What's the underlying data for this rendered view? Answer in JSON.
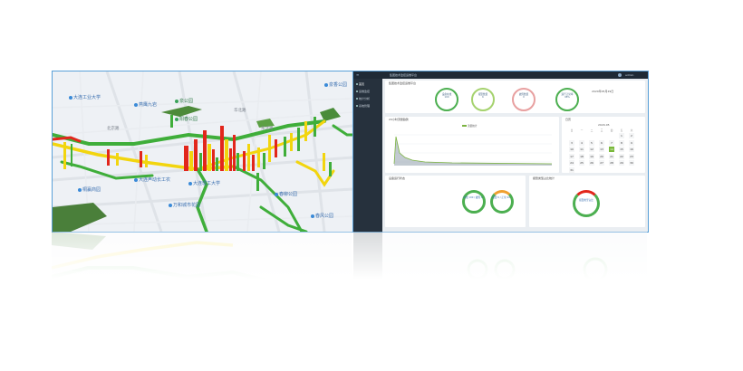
{
  "map": {
    "pois": [
      {
        "name": "大连工业大学",
        "tone": "blue"
      },
      {
        "name": "燕鹰九岩",
        "tone": "blue"
      },
      {
        "name": "泉公园",
        "tone": "green"
      },
      {
        "name": "阳春公园",
        "tone": "green"
      },
      {
        "name": "大连声动长工农",
        "tone": "blue"
      },
      {
        "name": "桐赢商园",
        "tone": "blue"
      },
      {
        "name": "大连理工大学",
        "tone": "blue"
      },
      {
        "name": "万和城市花园",
        "tone": "blue"
      },
      {
        "name": "春柳公园",
        "tone": "blue"
      },
      {
        "name": "泉香公园",
        "tone": "blue"
      },
      {
        "name": "春风公园",
        "tone": "blue"
      }
    ],
    "road_labels": [
      "华北路",
      "东北路",
      "北京路"
    ]
  },
  "dashboard": {
    "app_title": "集团技术监控运维平台",
    "user_label": "admin",
    "sidebar": [
      "首页",
      "运维监控",
      "统计分析",
      "系统管理"
    ],
    "kpi": [
      {
        "label": "设备在线",
        "value": "100",
        "color": "#4caf50"
      },
      {
        "label": "报警数量",
        "value": "6",
        "color": "#8bc34a"
      },
      {
        "label": "故障数量",
        "value": "0",
        "color": "#e8a0a0"
      },
      {
        "label": "运行正常率",
        "value": "98%",
        "color": "#4caf50"
      }
    ],
    "date_label": "2020年05月29日",
    "trend_title": "24小时流量趋势",
    "legend_label": "流量统计",
    "calendar_title": "日历",
    "calendar_month": "2020-05",
    "calendar_weekdays": [
      "日",
      "一",
      "二",
      "三",
      "四",
      "五",
      "六"
    ],
    "calendar_days": [
      "1",
      "2",
      "3",
      "4",
      "5",
      "6",
      "7",
      "8",
      "9",
      "10",
      "11",
      "12",
      "13",
      "14",
      "15",
      "16",
      "17",
      "18",
      "19",
      "20",
      "21",
      "22",
      "23",
      "24",
      "25",
      "26",
      "27",
      "28",
      "29",
      "30",
      "31"
    ],
    "selected_day": "14",
    "donut1_title": "设备运行状态",
    "donut1_center": "在线 100 / 故障 0",
    "donut2_center": "报警 6 / 正常 94",
    "donut3_title": "报警类型占比统计",
    "donut3_center": "报警类型占比"
  },
  "colors": {
    "traffic_green": "#3fae3a",
    "traffic_yellow": "#f2d50e",
    "traffic_red": "#e2261b",
    "sidebar_bg": "#26313d",
    "accent_green": "#4caf50"
  }
}
